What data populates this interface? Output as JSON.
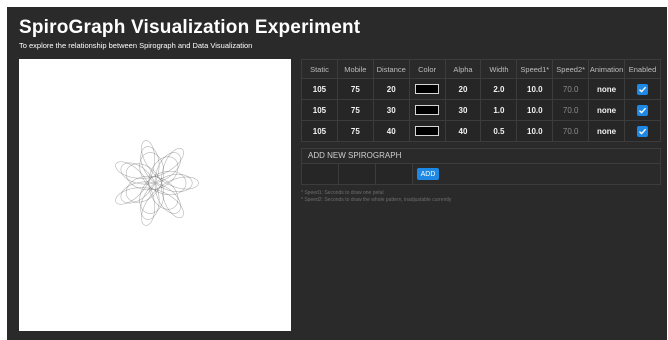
{
  "header": {
    "title": "SpiroGraph Visualization Experiment",
    "subtitle": "To explore the relationship between Spirograph and Data Visualization"
  },
  "table": {
    "columns": [
      "Static",
      "Mobile",
      "Distance",
      "Color",
      "Alpha",
      "Width",
      "Speed1*",
      "Speed2*",
      "Animation",
      "Enabled"
    ],
    "rows": [
      {
        "static": "105",
        "mobile": "75",
        "distance": "20",
        "color": "#000000",
        "alpha": "20",
        "width": "2.0",
        "speed1": "10.0",
        "speed2": "70.0",
        "animation": "none",
        "enabled": true
      },
      {
        "static": "105",
        "mobile": "75",
        "distance": "30",
        "color": "#000000",
        "alpha": "30",
        "width": "1.0",
        "speed1": "10.0",
        "speed2": "70.0",
        "animation": "none",
        "enabled": true
      },
      {
        "static": "105",
        "mobile": "75",
        "distance": "40",
        "color": "#000000",
        "alpha": "40",
        "width": "0.5",
        "speed1": "10.0",
        "speed2": "70.0",
        "animation": "none",
        "enabled": true
      }
    ]
  },
  "add_section": {
    "title": "ADD NEW SPIROGRAPH",
    "button_label": "ADD"
  },
  "notes": [
    "* Speed1: Seconds to draw one petal",
    "* Speed2: Seconds to draw the whole pattern, inadjustable currently"
  ],
  "colors": {
    "background": "#2a2a2a",
    "accent": "#1e88e5",
    "canvas": "#ffffff"
  }
}
